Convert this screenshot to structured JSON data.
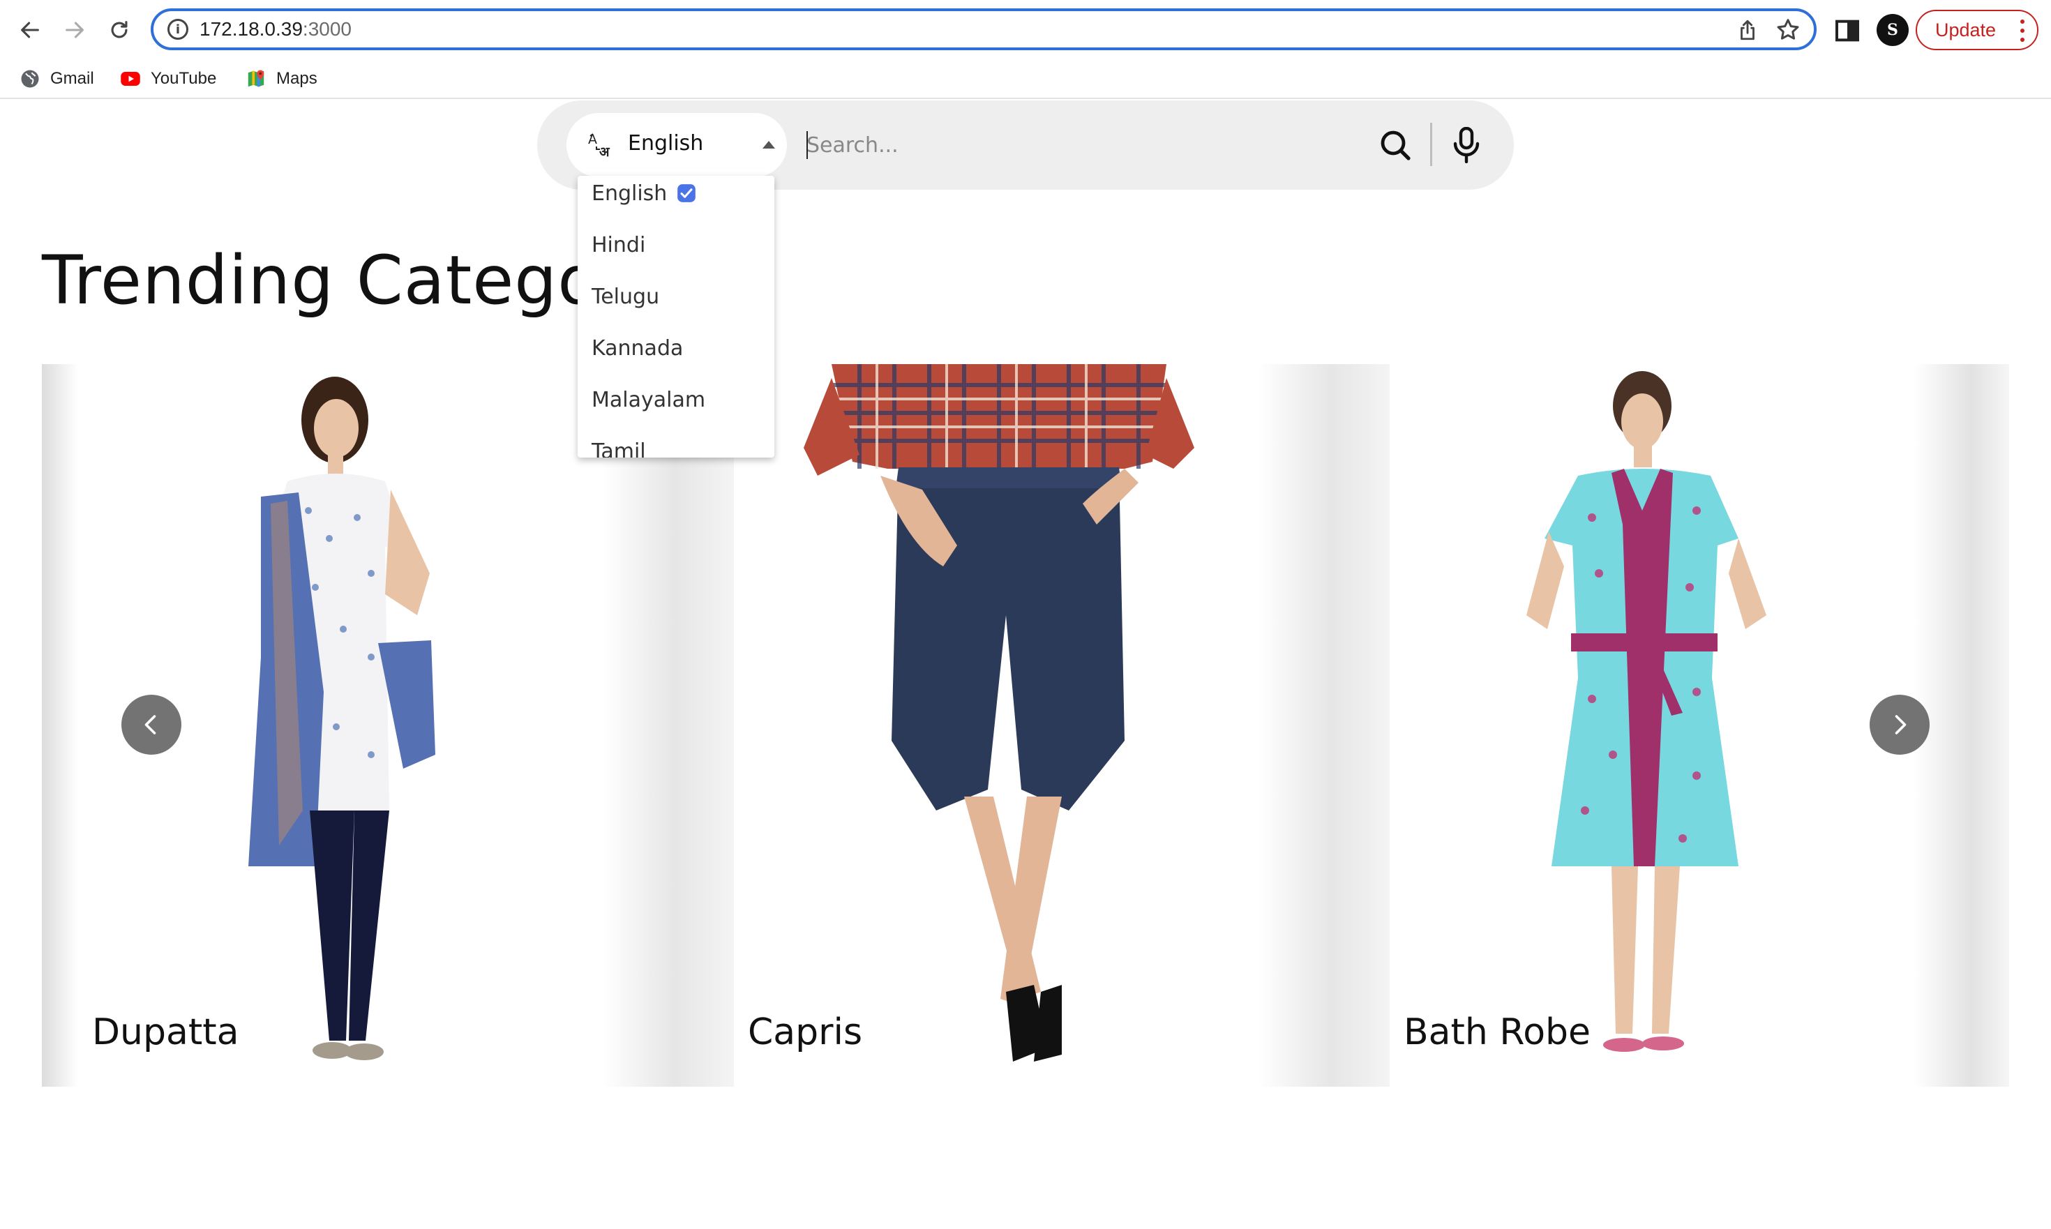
{
  "browser": {
    "url_host": "172.18.0.39",
    "url_port": ":3000",
    "update_label": "Update",
    "profile_initial": "S",
    "accent": "#2f6fd8",
    "update_color": "#c5221f"
  },
  "bookmarks": [
    {
      "label": "Gmail",
      "icon": "globe-icon"
    },
    {
      "label": "YouTube",
      "icon": "youtube-icon"
    },
    {
      "label": "Maps",
      "icon": "maps-icon"
    }
  ],
  "search": {
    "language_selected": "English",
    "placeholder": "Search...",
    "value": ""
  },
  "language_menu": {
    "options": [
      "English",
      "Hindi",
      "Telugu",
      "Kannada",
      "Malayalam",
      "Tamil"
    ],
    "selected": "English",
    "check_color": "#4a73e8"
  },
  "section": {
    "title": "Trending Catego"
  },
  "categories": [
    {
      "label": "Dupatta"
    },
    {
      "label": "Capris"
    },
    {
      "label": "Bath Robe"
    }
  ]
}
